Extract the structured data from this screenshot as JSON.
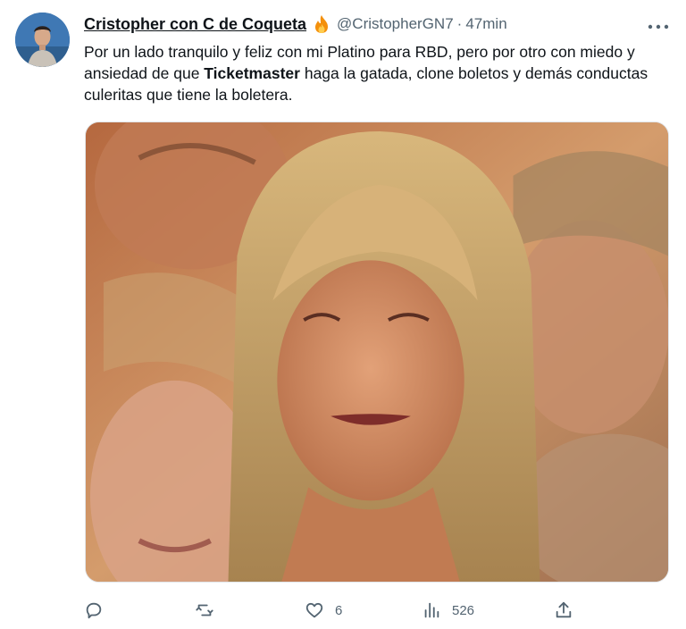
{
  "tweet": {
    "display_name": "Cristopher con C de Coqueta",
    "handle": "@CristopherGN7",
    "separator": "·",
    "time": "47min",
    "text_before": "Por un lado tranquilo y feliz con mi Platino para RBD, pero por otro con miedo y ansiedad de que ",
    "text_bold": "Ticketmaster",
    "text_after": " haga la gatada, clone boletos y demás conductas culeritas que tiene la boletera."
  },
  "actions": {
    "reply_count": "",
    "retweet_count": "",
    "like_count": "6",
    "views_count": "526"
  },
  "icons": {
    "name_badge": "fire-icon",
    "more": "more-icon",
    "reply": "reply-icon",
    "retweet": "retweet-icon",
    "like": "heart-icon",
    "views": "views-icon",
    "share": "share-icon"
  },
  "colors": {
    "text": "#0f1419",
    "secondary": "#536471",
    "fire": "#f4900c"
  }
}
